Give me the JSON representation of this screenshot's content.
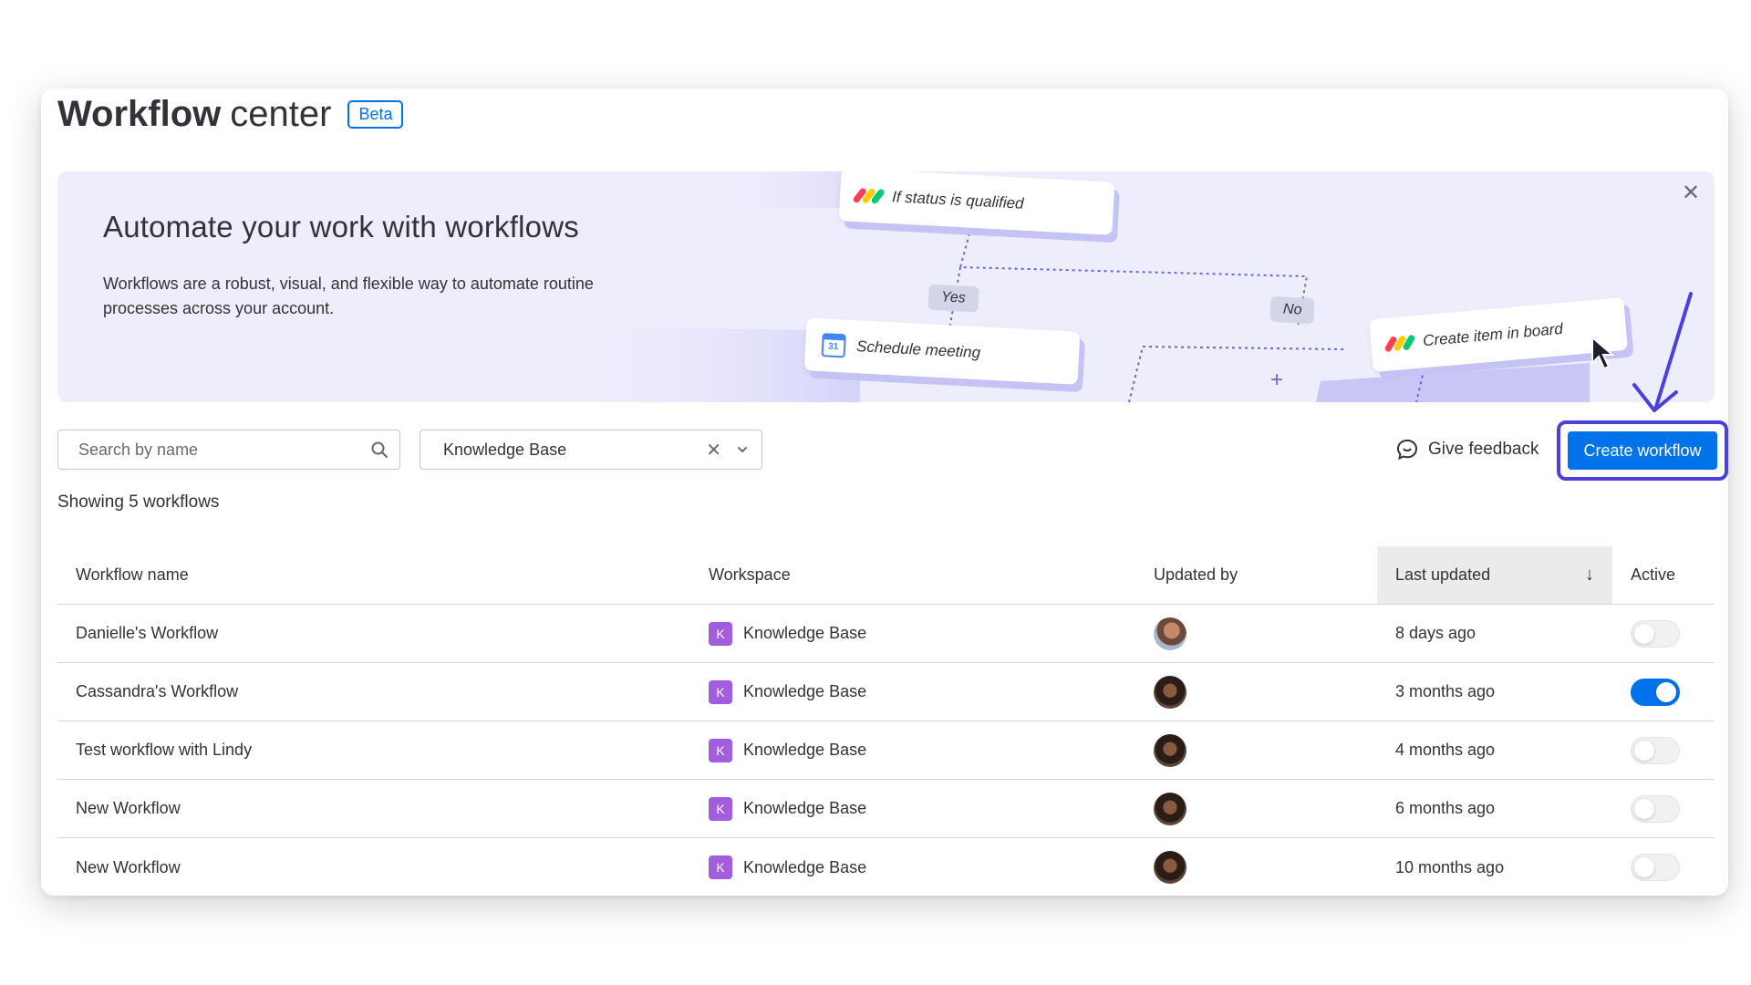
{
  "page": {
    "title_strong": "Workflow",
    "title_light": "center",
    "beta": "Beta"
  },
  "banner": {
    "title": "Automate your work with workflows",
    "description": "Workflows are a robust, visual, and flexible way to automate routine processes across your account.",
    "flow": {
      "trigger": "If status is qualified",
      "yes": "Yes",
      "no": "No",
      "action_yes": "Schedule meeting",
      "action_no": "Create item in board",
      "add": "+"
    }
  },
  "filters": {
    "search_placeholder": "Search by name",
    "workspace_value": "Knowledge Base"
  },
  "actions": {
    "feedback": "Give feedback",
    "create": "Create workflow"
  },
  "summary": "Showing 5 workflows",
  "table": {
    "headers": {
      "name": "Workflow name",
      "workspace": "Workspace",
      "updated_by": "Updated by",
      "last_updated": "Last updated",
      "active": "Active"
    },
    "rows": [
      {
        "name": "Danielle's Workflow",
        "ws_letter": "K",
        "workspace": "Knowledge Base",
        "last_updated": "8 days ago",
        "active": false
      },
      {
        "name": "Cassandra's Workflow",
        "ws_letter": "K",
        "workspace": "Knowledge Base",
        "last_updated": "3 months ago",
        "active": true
      },
      {
        "name": "Test workflow with Lindy",
        "ws_letter": "K",
        "workspace": "Knowledge Base",
        "last_updated": "4 months ago",
        "active": false
      },
      {
        "name": "New Workflow",
        "ws_letter": "K",
        "workspace": "Knowledge Base",
        "last_updated": "6 months ago",
        "active": false
      },
      {
        "name": "New Workflow",
        "ws_letter": "K",
        "workspace": "Knowledge Base",
        "last_updated": "10 months ago",
        "active": false
      }
    ]
  },
  "colors": {
    "primary": "#0073ea",
    "highlight": "#4c3fdc",
    "workspace_badge": "#a25ddc",
    "banner_bg": "#eeedfc"
  }
}
